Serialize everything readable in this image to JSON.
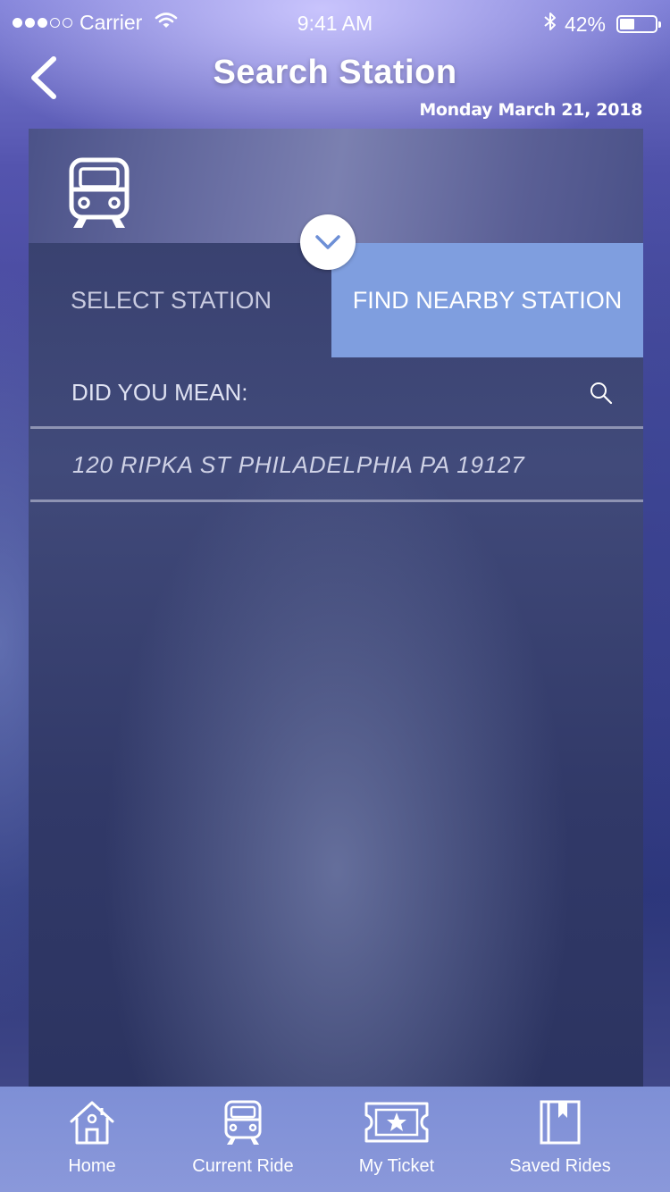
{
  "status_bar": {
    "carrier": "Carrier",
    "time": "9:41 AM",
    "battery_percent": "42%",
    "battery_level": 0.42,
    "signal_bars_filled": 3,
    "signal_bars_total": 5
  },
  "header": {
    "title": "Search Station",
    "date": "Monday March 21, 2018"
  },
  "tabs": {
    "select_station": "SELECT STATION",
    "find_nearby": "FIND NEARBY STATION"
  },
  "search": {
    "label": "DID YOU MEAN:"
  },
  "results": [
    "120 RIPKA ST PHILADELPHIA PA 19127"
  ],
  "bottom_nav": [
    {
      "label": "Home",
      "icon": "home-icon"
    },
    {
      "label": "Current Ride",
      "icon": "train-icon"
    },
    {
      "label": "My Ticket",
      "icon": "ticket-icon"
    },
    {
      "label": "Saved Rides",
      "icon": "bookmark-icon"
    }
  ],
  "colors": {
    "active_tab": "#7f9edf",
    "tab_bar": "#8494d8",
    "card_bg": "#353d6b"
  }
}
